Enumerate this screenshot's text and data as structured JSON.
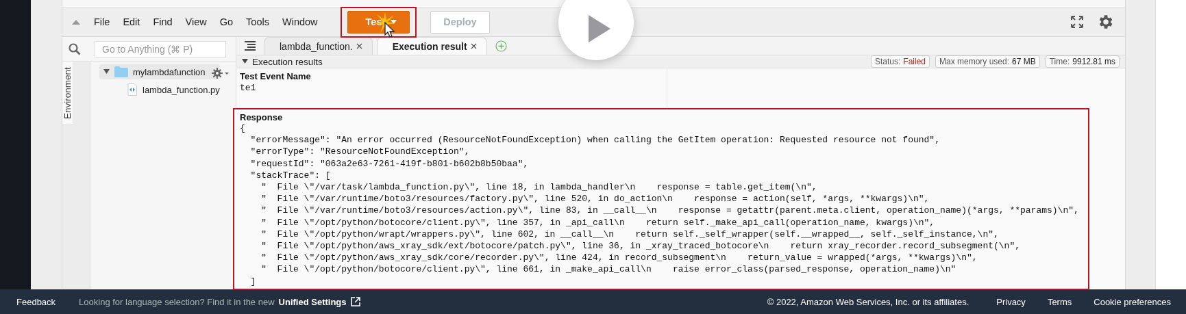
{
  "menu": [
    {
      "label": "File"
    },
    {
      "label": "Edit"
    },
    {
      "label": "Find"
    },
    {
      "label": "View"
    },
    {
      "label": "Go"
    },
    {
      "label": "Tools"
    },
    {
      "label": "Window"
    }
  ],
  "toolbar_buttons": [
    {
      "label": "Test",
      "kind": "primary",
      "disabled": false,
      "highlighted": true
    },
    {
      "label": "Deploy",
      "kind": "secondary",
      "disabled": true,
      "highlighted": false
    }
  ],
  "search": {
    "placeholder": "Go to Anything (⌘ P)"
  },
  "side_tab": {
    "label": "Environment",
    "selected": true
  },
  "tree": [
    {
      "name": "mylambdafunction",
      "kind": "folder",
      "expanded": true,
      "children": [
        {
          "name": "lambda_function.py",
          "kind": "file"
        }
      ]
    }
  ],
  "editor_tabs": [
    {
      "label": "lambda_function.",
      "selected": false
    },
    {
      "label": "Execution result",
      "selected": true
    }
  ],
  "panel": {
    "title": "Execution results",
    "expanded": true
  },
  "badges": [
    {
      "label": "Status:",
      "value": "Failed",
      "kind": "status"
    },
    {
      "label": "Max memory used:",
      "value": "67 MB",
      "kind": "plain"
    },
    {
      "label": "Time:",
      "value": "9912.81 ms",
      "kind": "plain"
    }
  ],
  "test_event": {
    "label": "Test Event Name",
    "value": "te1"
  },
  "response": {
    "label": "Response",
    "highlighted": true,
    "lines": [
      "{",
      "  \"errorMessage\": \"An error occurred (ResourceNotFoundException) when calling the GetItem operation: Requested resource not found\",",
      "  \"errorType\": \"ResourceNotFoundException\",",
      "  \"requestId\": \"063a2e63-7261-419f-b801-b602b8b50baa\",",
      "  \"stackTrace\": [",
      "    \"  File \\\"/var/task/lambda_function.py\\\", line 18, in lambda_handler\\n    response = table.get_item(\\n\",",
      "    \"  File \\\"/var/runtime/boto3/resources/factory.py\\\", line 520, in do_action\\n    response = action(self, *args, **kwargs)\\n\",",
      "    \"  File \\\"/var/runtime/boto3/resources/action.py\\\", line 83, in __call__\\n    response = getattr(parent.meta.client, operation_name)(*args, **params)\\n\",",
      "    \"  File \\\"/opt/python/botocore/client.py\\\", line 357, in _api_call\\n    return self._make_api_call(operation_name, kwargs)\\n\",",
      "    \"  File \\\"/opt/python/wrapt/wrappers.py\\\", line 602, in __call__\\n    return self._self_wrapper(self.__wrapped__, self._self_instance,\\n\",",
      "    \"  File \\\"/opt/python/aws_xray_sdk/ext/botocore/patch.py\\\", line 36, in _xray_traced_botocore\\n    return xray_recorder.record_subsegment(\\n\",",
      "    \"  File \\\"/opt/python/aws_xray_sdk/core/recorder.py\\\", line 424, in record_subsegment\\n    return_value = wrapped(*args, **kwargs)\\n\",",
      "    \"  File \\\"/opt/python/botocore/client.py\\\", line 661, in _make_api_call\\n    raise error_class(parsed_response, operation_name)\\n\"",
      "  ]"
    ]
  },
  "footer": {
    "feedback": "Feedback",
    "notice": "Looking for language selection? Find it in the new",
    "link": "Unified Settings",
    "copyright": "© 2022, Amazon Web Services, Inc. or its affiliates.",
    "links": [
      {
        "label": "Privacy"
      },
      {
        "label": "Terms"
      },
      {
        "label": "Cookie preferences"
      }
    ]
  }
}
